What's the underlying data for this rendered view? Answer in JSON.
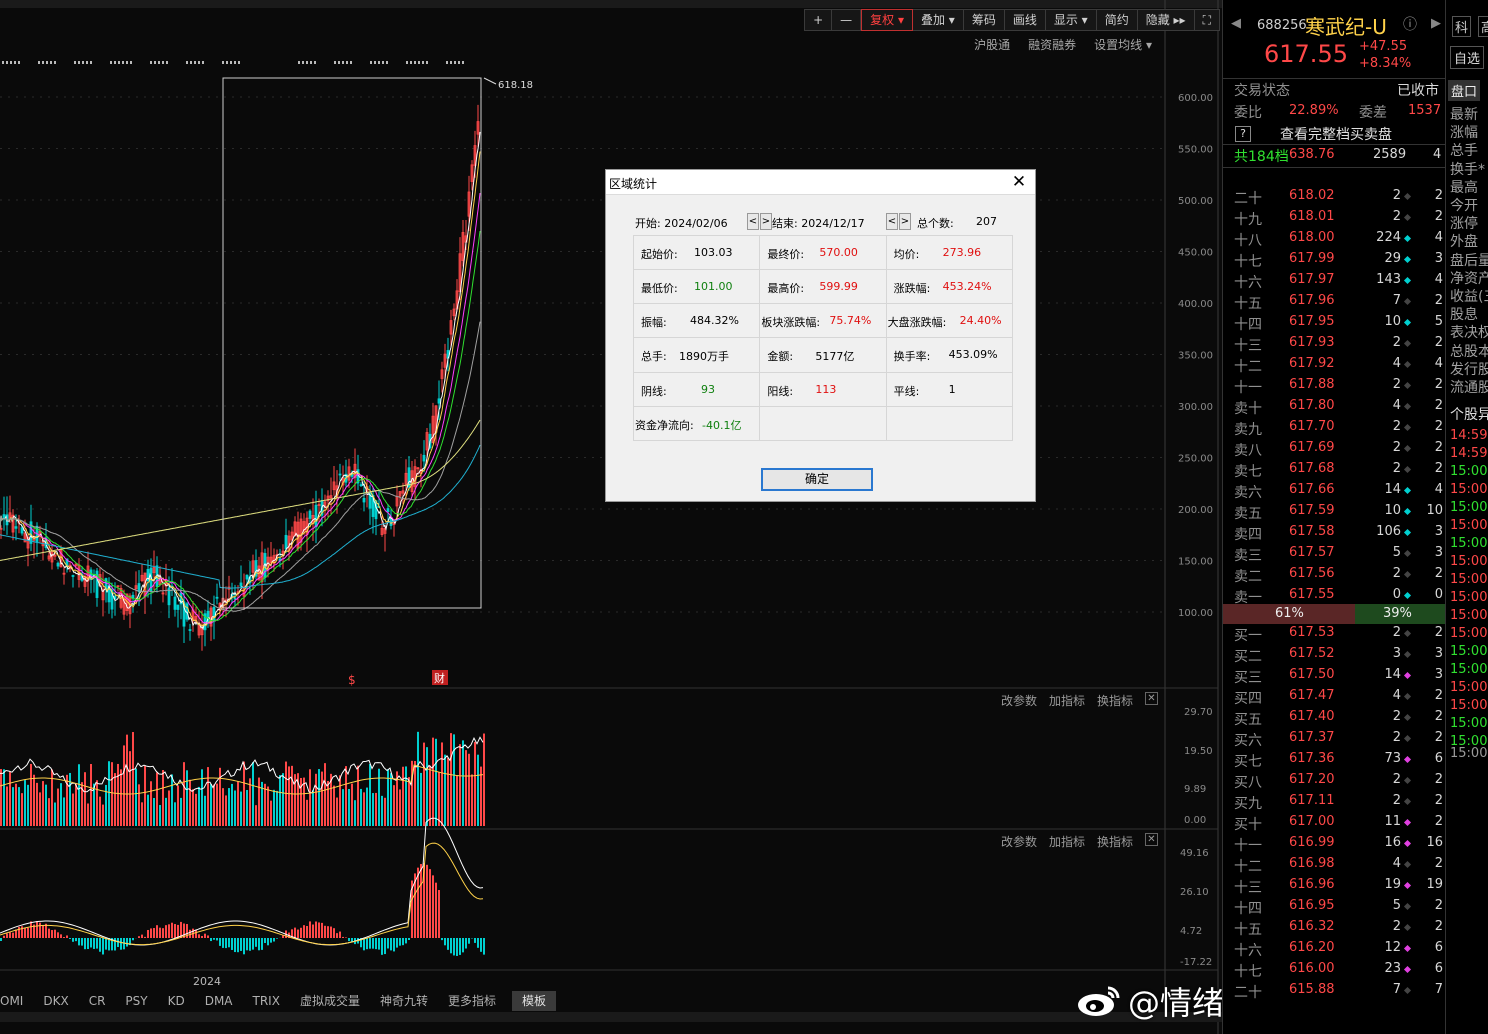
{
  "toolbar": {
    "items": [
      "+",
      "—",
      "复权 ▾",
      "叠加 ▾",
      "筹码",
      "画线",
      "显示 ▾",
      "简约",
      "隐藏 ▸▸",
      "⛶"
    ],
    "sub": [
      "沪股通",
      "融资融券",
      "设置均线 ▾"
    ]
  },
  "chart": {
    "price_ticks": [
      "600.00",
      "550.00",
      "500.00",
      "450.00",
      "400.00",
      "350.00",
      "300.00",
      "250.00",
      "200.00",
      "150.00",
      "100.00"
    ],
    "max_marker": "618.18",
    "event_markers": [
      "$",
      "财"
    ],
    "year_label": "2024",
    "vol_ticks": [
      "29.70",
      "19.50",
      "9.89",
      "0.00"
    ],
    "macd_ticks": [
      "49.16",
      "26.10",
      "4.72",
      "-17.22"
    ],
    "sub_tools": [
      "改参数",
      "加指标",
      "换指标",
      "✕"
    ]
  },
  "bottom_tabs": [
    "OMI",
    "DKX",
    "CR",
    "PSY",
    "KD",
    "DMA",
    "TRIX",
    "虚拟成交量",
    "神奇九转",
    "更多指标",
    "模板"
  ],
  "watermark": "@情绪龙头擒妖战法",
  "dialog": {
    "title": "区域统计",
    "start_label": "开始: 2024/02/06",
    "end_label": "结束: 2024/12/17",
    "count_label": "总个数:",
    "count_value": "207",
    "cells": [
      [
        "起始价:",
        "103.03",
        "最终价:",
        "570.00",
        "均价:",
        "273.96"
      ],
      [
        "最低价:",
        "101.00",
        "最高价:",
        "599.99",
        "涨跌幅:",
        "453.24%"
      ],
      [
        "振幅:",
        "484.32%",
        "板块涨跌幅:",
        "75.74%",
        "大盘涨跌幅:",
        "24.40%"
      ],
      [
        "总手:",
        "1890万手",
        "金额:",
        "5177亿",
        "换手率:",
        "453.09%"
      ],
      [
        "阴线:",
        "93",
        "阳线:",
        "113",
        "平线:",
        "1"
      ],
      [
        "资金净流向:",
        "-40.1亿"
      ]
    ],
    "ok_label": "确定"
  },
  "stock": {
    "code": "688256",
    "name": "寒武纪-U",
    "price": "617.55",
    "change": "+47.55",
    "change_pct": "+8.34%",
    "side_tabs": [
      "科",
      "高"
    ],
    "self_select": "自选",
    "status_label": "交易状态",
    "status_value": "已收市",
    "weibi_label": "委比",
    "weibi_value": "22.89%",
    "weicha_label": "委差",
    "weicha_value": "1537",
    "full_book": "查看完整档买卖盘",
    "total_levels": "共184档",
    "total_price": "638.76",
    "total_vol": "2589",
    "total_cnt": "4",
    "ratio_left": "61%",
    "ratio_right": "39%",
    "panel_tab": "盘口"
  },
  "sell_levels": [
    [
      "二十",
      "618.02",
      "2",
      "2"
    ],
    [
      "十九",
      "618.01",
      "2",
      "2"
    ],
    [
      "十八",
      "618.00",
      "224",
      "4"
    ],
    [
      "十七",
      "617.99",
      "29",
      "3"
    ],
    [
      "十六",
      "617.97",
      "143",
      "4"
    ],
    [
      "十五",
      "617.96",
      "7",
      "2"
    ],
    [
      "十四",
      "617.95",
      "10",
      "5"
    ],
    [
      "十三",
      "617.93",
      "2",
      "2"
    ],
    [
      "十二",
      "617.92",
      "4",
      "4"
    ],
    [
      "十一",
      "617.88",
      "2",
      "2"
    ],
    [
      "卖十",
      "617.80",
      "4",
      "2"
    ],
    [
      "卖九",
      "617.70",
      "2",
      "2"
    ],
    [
      "卖八",
      "617.69",
      "2",
      "2"
    ],
    [
      "卖七",
      "617.68",
      "2",
      "2"
    ],
    [
      "卖六",
      "617.66",
      "14",
      "4"
    ],
    [
      "卖五",
      "617.59",
      "10",
      "10"
    ],
    [
      "卖四",
      "617.58",
      "106",
      "3"
    ],
    [
      "卖三",
      "617.57",
      "5",
      "3"
    ],
    [
      "卖二",
      "617.56",
      "2",
      "2"
    ],
    [
      "卖一",
      "617.55",
      "0",
      "0"
    ]
  ],
  "buy_levels": [
    [
      "买一",
      "617.53",
      "2",
      "2"
    ],
    [
      "买二",
      "617.52",
      "3",
      "3"
    ],
    [
      "买三",
      "617.50",
      "14",
      "3"
    ],
    [
      "买四",
      "617.47",
      "4",
      "2"
    ],
    [
      "买五",
      "617.40",
      "2",
      "2"
    ],
    [
      "买六",
      "617.37",
      "2",
      "2"
    ],
    [
      "买七",
      "617.36",
      "73",
      "6"
    ],
    [
      "买八",
      "617.20",
      "2",
      "2"
    ],
    [
      "买九",
      "617.11",
      "2",
      "2"
    ],
    [
      "买十",
      "617.00",
      "11",
      "2"
    ],
    [
      "十一",
      "616.99",
      "16",
      "16"
    ],
    [
      "十二",
      "616.98",
      "4",
      "2"
    ],
    [
      "十三",
      "616.96",
      "19",
      "19"
    ],
    [
      "十四",
      "616.95",
      "5",
      "2"
    ],
    [
      "十五",
      "616.32",
      "2",
      "2"
    ],
    [
      "十六",
      "616.20",
      "12",
      "6"
    ],
    [
      "十七",
      "616.00",
      "23",
      "6"
    ],
    [
      "二十",
      "615.88",
      "7",
      "7"
    ]
  ],
  "side_labels": [
    "最新",
    "涨幅",
    "总手",
    "换手*",
    "最高",
    "今开",
    "涨停",
    "外盘",
    "盘后量",
    "净资产",
    "收益(三",
    "股息",
    "表决权",
    "总股本",
    "发行股",
    "流通股",
    "个股异"
  ],
  "side_times": [
    "14:59",
    "14:59",
    "15:00",
    "15:00",
    "15:00",
    "15:00",
    "15:00",
    "15:00",
    "15:00",
    "15:00",
    "15:00",
    "15:00",
    "15:00",
    "15:00",
    "15:00",
    "15:00",
    "15:00",
    "15:00",
    "15:00"
  ],
  "colors": {
    "up": "#ff4848",
    "down": "#00d0d0",
    "green": "#30e030",
    "bg": "#000000"
  }
}
